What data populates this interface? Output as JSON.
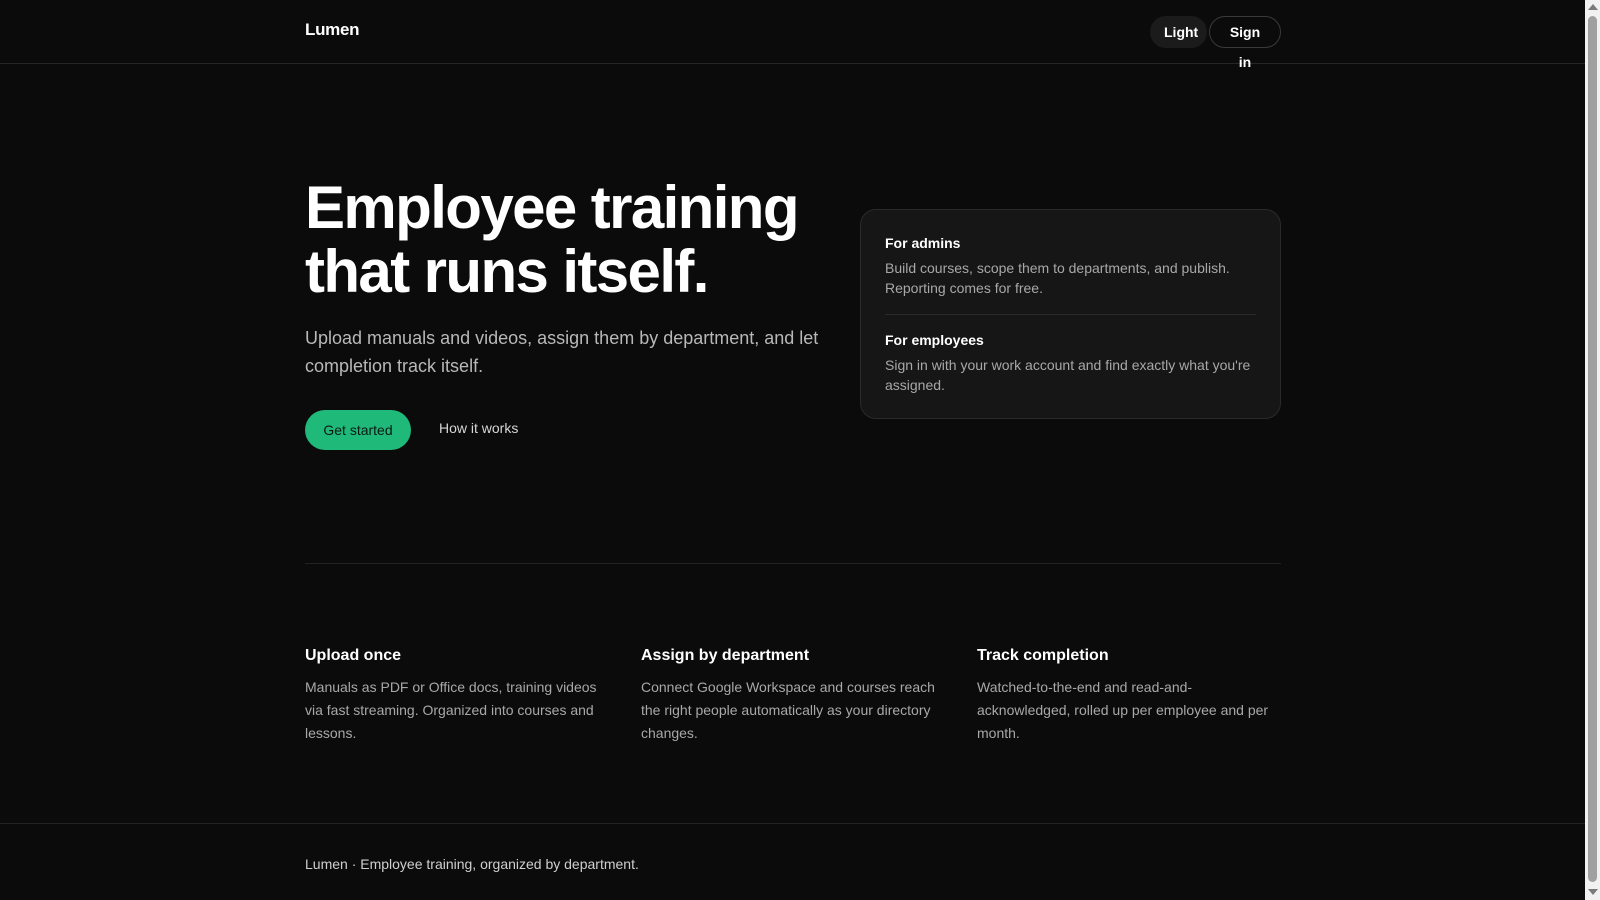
{
  "header": {
    "brand": "Lumen",
    "theme_button": "Light",
    "signin_button": "Sign in"
  },
  "hero": {
    "title": "Employee training that runs itself.",
    "subtitle": "Upload manuals and videos, assign them by department, and let completion track itself.",
    "cta_primary": "Get started",
    "cta_secondary": "How it works"
  },
  "audience": {
    "admins": {
      "heading": "For admins",
      "text": "Build courses, scope them to departments, and publish. Reporting comes for free."
    },
    "employees": {
      "heading": "For employees",
      "text": "Sign in with your work account and find exactly what you're assigned."
    }
  },
  "features": [
    {
      "title": "Upload once",
      "text": "Manuals as PDF or Office docs, training videos via fast streaming. Organized into courses and lessons."
    },
    {
      "title": "Assign by department",
      "text": "Connect Google Workspace and courses reach the right people automatically as your directory changes."
    },
    {
      "title": "Track completion",
      "text": "Watched-to-the-end and read-and-acknowledged, rolled up per employee and per month."
    }
  ],
  "footer": {
    "text": "Lumen · Employee training, organized by department."
  },
  "colors": {
    "background": "#0b0b0b",
    "accent": "#1fb97a",
    "card": "#161616",
    "muted_text": "#a8a8a8"
  }
}
